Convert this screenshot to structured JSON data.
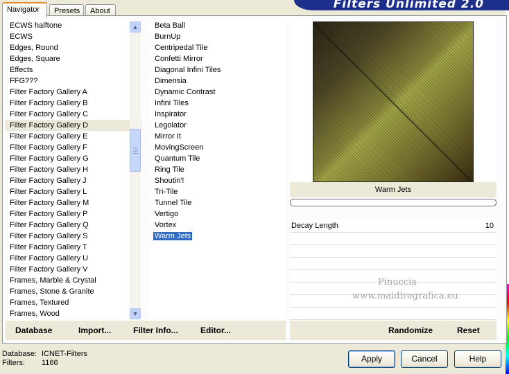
{
  "tabs": [
    {
      "label": "Navigator",
      "active": true
    },
    {
      "label": "Presets",
      "active": false
    },
    {
      "label": "About",
      "active": false
    }
  ],
  "banner": {
    "title": "Filters Unlimited 2.0"
  },
  "categories": {
    "items": [
      "ECWS halftone",
      "ECWS",
      "Edges, Round",
      "Edges, Square",
      "Effects",
      "FFG???",
      "Filter Factory Gallery A",
      "Filter Factory Gallery B",
      "Filter Factory Gallery C",
      "Filter Factory Gallery D",
      "Filter Factory Gallery E",
      "Filter Factory Gallery F",
      "Filter Factory Gallery G",
      "Filter Factory Gallery H",
      "Filter Factory Gallery J",
      "Filter Factory Gallery L",
      "Filter Factory Gallery M",
      "Filter Factory Gallery P",
      "Filter Factory Gallery Q",
      "Filter Factory Gallery S",
      "Filter Factory Gallery T",
      "Filter Factory Gallery U",
      "Filter Factory Gallery V",
      "Frames, Marble & Crystal",
      "Frames, Stone & Granite",
      "Frames, Textured",
      "Frames, Wood"
    ],
    "selected_index": 9
  },
  "filters": {
    "items": [
      "Beta Ball",
      "BurnUp",
      "Centripedal Tile",
      "Confetti Mirror",
      "Diagonal Infini Tiles",
      "Dimensia",
      "Dynamic Contrast",
      "Infini Tiles",
      "Inspirator",
      "Legolator",
      "Mirror It",
      "MovingScreen",
      "Quantum Tile",
      "Ring Tile",
      "Shoutin'!",
      "Tri-Tile",
      "Tunnel Tile",
      "Vertigo",
      "Vortex",
      "Warm Jets"
    ],
    "selected_index": 19
  },
  "preview": {
    "filter_name": "Warm Jets",
    "progress": 0
  },
  "params": [
    {
      "name": "Decay Length",
      "value": "10"
    }
  ],
  "watermark": {
    "line1": "Pinuccia",
    "line2": "www.maidiregrafica.eu"
  },
  "left_bar": {
    "database": "Database",
    "import": "Import...",
    "filter_info": "Filter Info...",
    "editor": "Editor..."
  },
  "right_bar": {
    "randomize": "Randomize",
    "reset": "Reset"
  },
  "info": {
    "database_label": "Database:",
    "database_value": "ICNET-Filters",
    "filters_label": "Filters:",
    "filters_value": "1166"
  },
  "buttons": {
    "apply": "Apply",
    "cancel": "Cancel",
    "help": "Help"
  }
}
